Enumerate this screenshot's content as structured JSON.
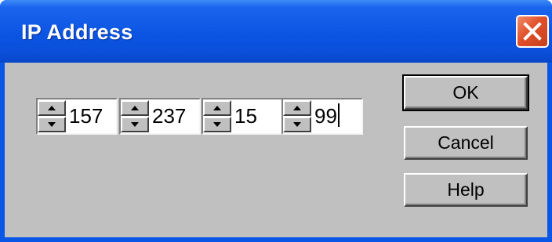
{
  "window": {
    "title": "IP Address"
  },
  "ip": {
    "octets": [
      "157",
      "237",
      "15",
      "99"
    ]
  },
  "buttons": {
    "ok_label": "OK",
    "cancel_label": "Cancel",
    "help_label": "Help"
  },
  "icons": {
    "close": "close-icon",
    "spin_up": "arrow-up-icon",
    "spin_down": "arrow-down-icon"
  },
  "colors": {
    "titlebar": "#0a55e3",
    "client": "#c0c0c0",
    "close_button": "#e0502a"
  }
}
